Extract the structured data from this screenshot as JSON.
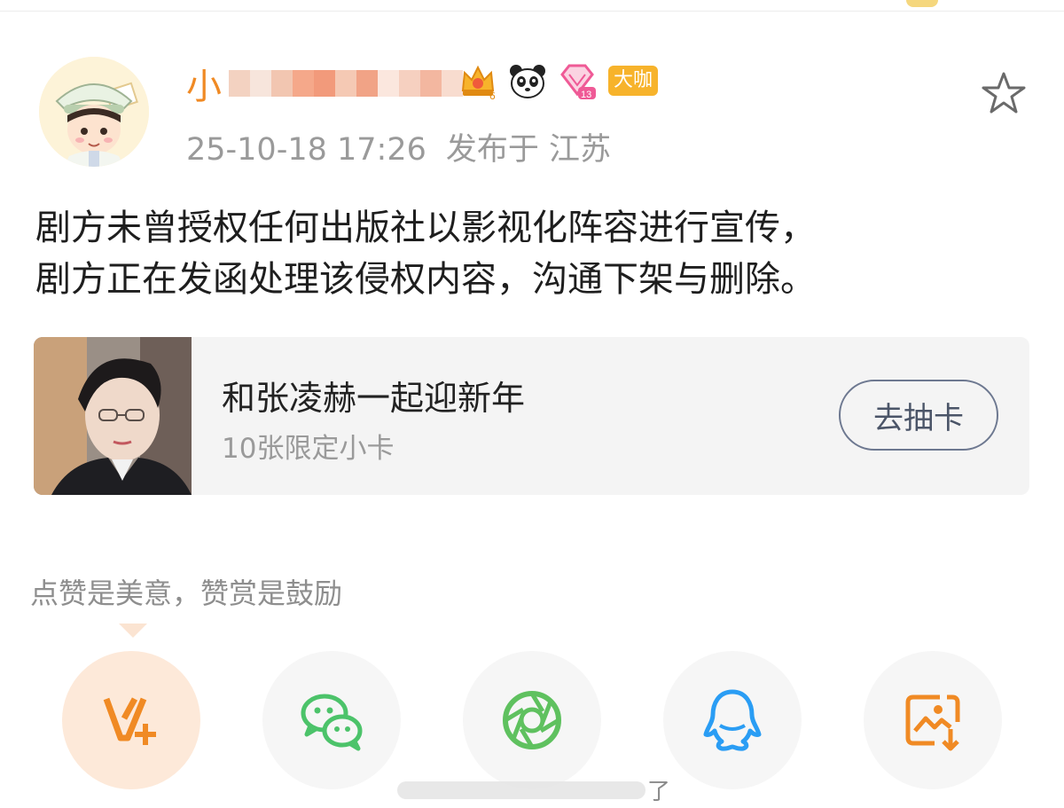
{
  "post": {
    "username": "小",
    "badge_label": "大咖",
    "timestamp": "25-10-18 17:26",
    "location_label": "发布于 江苏",
    "text_line1": "剧方未曾授权任何出版社以影视化阵容进行宣传，",
    "text_line2": "剧方正在发函处理该侵权内容，沟通下架与删除。"
  },
  "card": {
    "title": "和张凌赫一起迎新年",
    "subtitle": "10张限定小卡",
    "button_label": "去抽卡"
  },
  "reward": {
    "text": "点赞是美意，赞赏是鼓励"
  },
  "share": {
    "items": [
      {
        "icon": "vip-reward-icon"
      },
      {
        "icon": "wechat-icon"
      },
      {
        "icon": "moments-icon"
      },
      {
        "icon": "qq-icon"
      },
      {
        "icon": "save-image-icon"
      }
    ]
  },
  "watermark": {
    "char": "了"
  },
  "colors": {
    "username": "#f08a24",
    "badge": "#f7b32b",
    "wechat": "#4cc36a",
    "moments": "#5fc15f",
    "qq": "#2a9df4",
    "vip": "#f08a24"
  }
}
